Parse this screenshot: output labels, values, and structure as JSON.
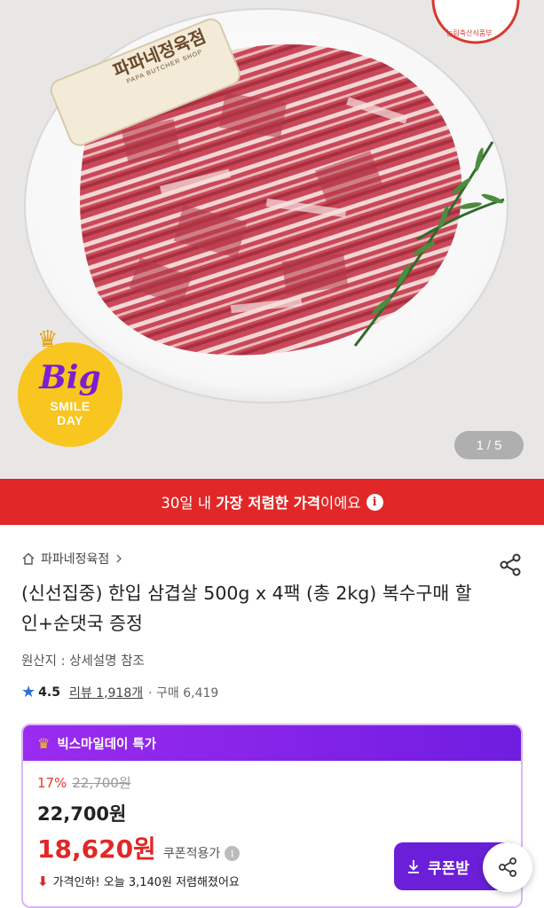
{
  "hero": {
    "logo_text": "파파네정육점",
    "logo_sub": "PAPA BUTCHER SHOP",
    "seal_text": "농림축산식품부",
    "badge": {
      "big": "Big",
      "line1": "SMILE",
      "line2": "DAY"
    },
    "pager": {
      "current": "1",
      "separator": "/",
      "total": "5"
    }
  },
  "banner": {
    "prefix": "30일 내 ",
    "highlight": "가장 저렴한 가격",
    "suffix": "이에요",
    "info_icon": "i"
  },
  "product": {
    "store": "파파네정육점",
    "title": "(신선집중) 한입 삼겹살 500g x 4팩 (총 2kg) 복수구매 할인+순댓국 증정",
    "origin": "원산지 : 상세설명 참조",
    "rating": "4.5",
    "review_label": "리뷰 1,918개",
    "purchase_label": "· 구매 6,419"
  },
  "promo": {
    "header": "빅스마일데이 특가",
    "discount_pct": "17%",
    "original_price": "22,700원",
    "sale_price": "22,700원",
    "coupon_price": "18,620원",
    "coupon_label": "쿠폰적용가",
    "price_drop": "가격인하! 오늘 3,140원 저렴해졌어요",
    "coupon_button": "쿠폰받"
  },
  "colors": {
    "banner_red": "#e12727",
    "promo_purple": "#6b1fd8",
    "rating_star": "#2f6fd6"
  }
}
